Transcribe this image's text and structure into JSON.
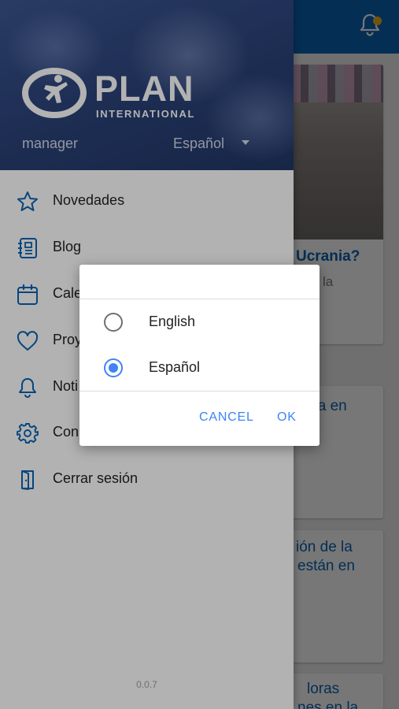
{
  "background": {
    "cards": [
      {
        "title_lines": [
          "Ucrania?"
        ],
        "subtitle": "la"
      },
      {
        "title_lines": [
          "cia en"
        ]
      },
      {
        "title_lines": [
          "ión de la",
          "están en"
        ]
      },
      {
        "title_lines": [
          "loras",
          "nes en la"
        ]
      }
    ]
  },
  "drawer": {
    "logo_text": "PLAN",
    "logo_subtext": "INTERNATIONAL",
    "user": "manager",
    "language": "Español",
    "menu": [
      {
        "label": "Novedades",
        "icon": "star-icon"
      },
      {
        "label": "Blog",
        "icon": "blog-icon"
      },
      {
        "label": "Cale",
        "icon": "calendar-icon"
      },
      {
        "label": "Proy",
        "icon": "heart-icon"
      },
      {
        "label": "Noti",
        "icon": "bell-icon"
      },
      {
        "label": "Con",
        "icon": "gear-icon"
      },
      {
        "label": "Cerrar sesión",
        "icon": "logout-icon"
      }
    ],
    "version": "0.0.7"
  },
  "dialog": {
    "options": [
      {
        "label": "English",
        "selected": false
      },
      {
        "label": "Español",
        "selected": true
      }
    ],
    "cancel_label": "CANCEL",
    "ok_label": "OK"
  },
  "colors": {
    "brand_blue": "#0b63b5",
    "accent_blue": "#3d85f5",
    "notification_dot": "#f7b31a"
  }
}
